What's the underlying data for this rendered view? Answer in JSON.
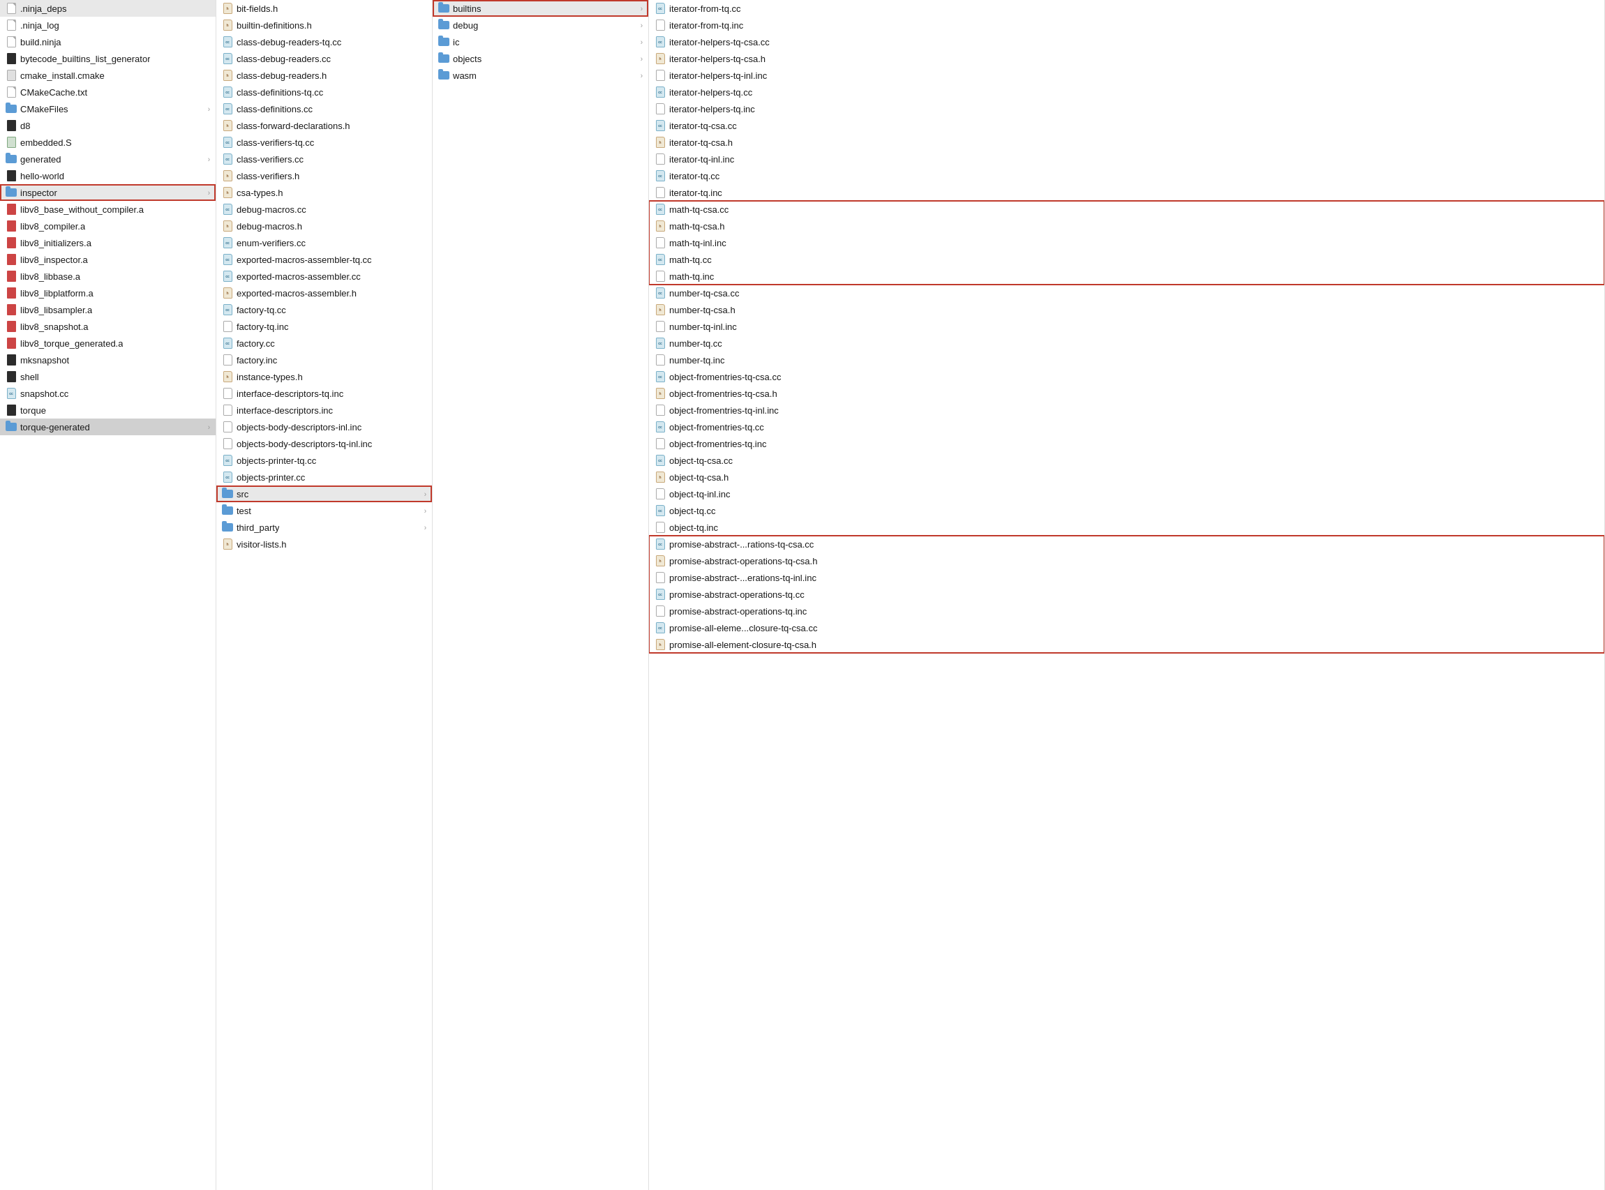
{
  "pane1": {
    "items": [
      {
        "name": ".ninja_deps",
        "type": "text",
        "indent": 0
      },
      {
        "name": ".ninja_log",
        "type": "text",
        "indent": 0
      },
      {
        "name": "build.ninja",
        "type": "text",
        "indent": 0
      },
      {
        "name": "bytecode_builtins_list_generator",
        "type": "executable",
        "indent": 0
      },
      {
        "name": "cmake_install.cmake",
        "type": "cmake",
        "indent": 0
      },
      {
        "name": "CMakeCache.txt",
        "type": "text",
        "indent": 0
      },
      {
        "name": "CMakeFiles",
        "type": "folder",
        "indent": 0,
        "chevron": true
      },
      {
        "name": "d8",
        "type": "executable",
        "indent": 0
      },
      {
        "name": "embedded.S",
        "type": "s",
        "indent": 0
      },
      {
        "name": "generated",
        "type": "folder",
        "indent": 0,
        "chevron": true
      },
      {
        "name": "hello-world",
        "type": "executable",
        "indent": 0
      },
      {
        "name": "inspector",
        "type": "folder",
        "indent": 0,
        "chevron": true,
        "highlighted": true
      },
      {
        "name": "libv8_base_without_compiler.a",
        "type": "archive",
        "indent": 0
      },
      {
        "name": "libv8_compiler.a",
        "type": "archive",
        "indent": 0
      },
      {
        "name": "libv8_initializers.a",
        "type": "archive",
        "indent": 0
      },
      {
        "name": "libv8_inspector.a",
        "type": "archive",
        "indent": 0
      },
      {
        "name": "libv8_libbase.a",
        "type": "archive",
        "indent": 0
      },
      {
        "name": "libv8_libplatform.a",
        "type": "archive",
        "indent": 0
      },
      {
        "name": "libv8_libsampler.a",
        "type": "archive",
        "indent": 0
      },
      {
        "name": "libv8_snapshot.a",
        "type": "archive",
        "indent": 0
      },
      {
        "name": "libv8_torque_generated.a",
        "type": "archive",
        "indent": 0
      },
      {
        "name": "mksnapshot",
        "type": "executable",
        "indent": 0
      },
      {
        "name": "shell",
        "type": "executable",
        "indent": 0
      },
      {
        "name": "snapshot.cc",
        "type": "cc",
        "indent": 0
      },
      {
        "name": "torque",
        "type": "executable",
        "indent": 0
      },
      {
        "name": "torque-generated",
        "type": "folder",
        "indent": 0,
        "chevron": true,
        "selected": true
      }
    ]
  },
  "pane2": {
    "items": [
      {
        "name": "bit-fields.h",
        "type": "h",
        "indent": 0
      },
      {
        "name": "builtin-definitions.h",
        "type": "h",
        "indent": 0
      },
      {
        "name": "class-debug-readers-tq.cc",
        "type": "cc",
        "indent": 0
      },
      {
        "name": "class-debug-readers.cc",
        "type": "cc",
        "indent": 0
      },
      {
        "name": "class-debug-readers.h",
        "type": "h",
        "indent": 0
      },
      {
        "name": "class-definitions-tq.cc",
        "type": "cc",
        "indent": 0
      },
      {
        "name": "class-definitions.cc",
        "type": "cc",
        "indent": 0
      },
      {
        "name": "class-forward-declarations.h",
        "type": "h",
        "indent": 0
      },
      {
        "name": "class-verifiers-tq.cc",
        "type": "cc",
        "indent": 0
      },
      {
        "name": "class-verifiers.cc",
        "type": "cc",
        "indent": 0
      },
      {
        "name": "class-verifiers.h",
        "type": "h",
        "indent": 0
      },
      {
        "name": "csa-types.h",
        "type": "h",
        "indent": 0
      },
      {
        "name": "debug-macros.cc",
        "type": "cc",
        "indent": 0
      },
      {
        "name": "debug-macros.h",
        "type": "h",
        "indent": 0
      },
      {
        "name": "enum-verifiers.cc",
        "type": "cc",
        "indent": 0
      },
      {
        "name": "exported-macros-assembler-tq.cc",
        "type": "cc",
        "indent": 0
      },
      {
        "name": "exported-macros-assembler.cc",
        "type": "cc",
        "indent": 0
      },
      {
        "name": "exported-macros-assembler.h",
        "type": "h",
        "indent": 0
      },
      {
        "name": "factory-tq.cc",
        "type": "cc",
        "indent": 0
      },
      {
        "name": "factory-tq.inc",
        "type": "inc",
        "indent": 0
      },
      {
        "name": "factory.cc",
        "type": "cc",
        "indent": 0
      },
      {
        "name": "factory.inc",
        "type": "inc",
        "indent": 0
      },
      {
        "name": "instance-types.h",
        "type": "h",
        "indent": 0
      },
      {
        "name": "interface-descriptors-tq.inc",
        "type": "inc",
        "indent": 0
      },
      {
        "name": "interface-descriptors.inc",
        "type": "inc",
        "indent": 0
      },
      {
        "name": "objects-body-descriptors-inl.inc",
        "type": "inc",
        "indent": 0
      },
      {
        "name": "objects-body-descriptors-tq-inl.inc",
        "type": "inc",
        "indent": 0
      },
      {
        "name": "objects-printer-tq.cc",
        "type": "cc",
        "indent": 0
      },
      {
        "name": "objects-printer.cc",
        "type": "cc",
        "indent": 0
      },
      {
        "name": "src",
        "type": "folder",
        "indent": 0,
        "chevron": true,
        "highlighted": true
      },
      {
        "name": "test",
        "type": "folder",
        "indent": 0,
        "chevron": true
      },
      {
        "name": "third_party",
        "type": "folder",
        "indent": 0,
        "chevron": true
      },
      {
        "name": "visitor-lists.h",
        "type": "h",
        "indent": 0
      }
    ]
  },
  "pane3": {
    "items": [
      {
        "name": "builtins",
        "type": "folder",
        "indent": 0,
        "chevron": true,
        "highlighted": true
      },
      {
        "name": "debug",
        "type": "folder",
        "indent": 0,
        "chevron": true
      },
      {
        "name": "ic",
        "type": "folder",
        "indent": 0,
        "chevron": true
      },
      {
        "name": "objects",
        "type": "folder",
        "indent": 0,
        "chevron": true
      },
      {
        "name": "wasm",
        "type": "folder",
        "indent": 0,
        "chevron": true
      }
    ]
  },
  "pane4": {
    "items": [
      {
        "name": "iterator-from-tq.cc",
        "type": "cc",
        "indent": 0
      },
      {
        "name": "iterator-from-tq.inc",
        "type": "inc",
        "indent": 0
      },
      {
        "name": "iterator-helpers-tq-csa.cc",
        "type": "cc",
        "indent": 0
      },
      {
        "name": "iterator-helpers-tq-csa.h",
        "type": "h",
        "indent": 0
      },
      {
        "name": "iterator-helpers-tq-inl.inc",
        "type": "inc",
        "indent": 0
      },
      {
        "name": "iterator-helpers-tq.cc",
        "type": "cc",
        "indent": 0
      },
      {
        "name": "iterator-helpers-tq.inc",
        "type": "inc",
        "indent": 0
      },
      {
        "name": "iterator-tq-csa.cc",
        "type": "cc",
        "indent": 0
      },
      {
        "name": "iterator-tq-csa.h",
        "type": "h",
        "indent": 0
      },
      {
        "name": "iterator-tq-inl.inc",
        "type": "inc",
        "indent": 0
      },
      {
        "name": "iterator-tq.cc",
        "type": "cc",
        "indent": 0
      },
      {
        "name": "iterator-tq.inc",
        "type": "inc",
        "indent": 0
      },
      {
        "name": "math-tq-csa.cc",
        "type": "cc",
        "indent": 0,
        "highlighted": true
      },
      {
        "name": "math-tq-csa.h",
        "type": "h",
        "indent": 0,
        "highlighted": true
      },
      {
        "name": "math-tq-inl.inc",
        "type": "inc",
        "indent": 0,
        "highlighted": true
      },
      {
        "name": "math-tq.cc",
        "type": "cc",
        "indent": 0,
        "highlighted": true
      },
      {
        "name": "math-tq.inc",
        "type": "inc",
        "indent": 0,
        "highlighted": true
      },
      {
        "name": "number-tq-csa.cc",
        "type": "cc",
        "indent": 0
      },
      {
        "name": "number-tq-csa.h",
        "type": "h",
        "indent": 0
      },
      {
        "name": "number-tq-inl.inc",
        "type": "inc",
        "indent": 0
      },
      {
        "name": "number-tq.cc",
        "type": "cc",
        "indent": 0
      },
      {
        "name": "number-tq.inc",
        "type": "inc",
        "indent": 0
      },
      {
        "name": "object-fromentries-tq-csa.cc",
        "type": "cc",
        "indent": 0
      },
      {
        "name": "object-fromentries-tq-csa.h",
        "type": "h",
        "indent": 0
      },
      {
        "name": "object-fromentries-tq-inl.inc",
        "type": "inc",
        "indent": 0
      },
      {
        "name": "object-fromentries-tq.cc",
        "type": "cc",
        "indent": 0
      },
      {
        "name": "object-fromentries-tq.inc",
        "type": "inc",
        "indent": 0
      },
      {
        "name": "object-tq-csa.cc",
        "type": "cc",
        "indent": 0
      },
      {
        "name": "object-tq-csa.h",
        "type": "h",
        "indent": 0
      },
      {
        "name": "object-tq-inl.inc",
        "type": "inc",
        "indent": 0
      },
      {
        "name": "object-tq.cc",
        "type": "cc",
        "indent": 0
      },
      {
        "name": "object-tq.inc",
        "type": "inc",
        "indent": 0
      },
      {
        "name": "promise-abstract-...rations-tq-csa.cc",
        "type": "cc",
        "indent": 0,
        "highlighted": true
      },
      {
        "name": "promise-abstract-operations-tq-csa.h",
        "type": "h",
        "indent": 0,
        "highlighted": true
      },
      {
        "name": "promise-abstract-...erations-tq-inl.inc",
        "type": "inc",
        "indent": 0,
        "highlighted": true
      },
      {
        "name": "promise-abstract-operations-tq.cc",
        "type": "cc",
        "indent": 0,
        "highlighted": true
      },
      {
        "name": "promise-abstract-operations-tq.inc",
        "type": "inc",
        "indent": 0,
        "highlighted": true
      },
      {
        "name": "promise-all-eleme...closure-tq-csa.cc",
        "type": "cc",
        "indent": 0,
        "highlighted": true
      },
      {
        "name": "promise-all-element-closure-tq-csa.h",
        "type": "h",
        "indent": 0,
        "highlighted": true
      }
    ]
  }
}
